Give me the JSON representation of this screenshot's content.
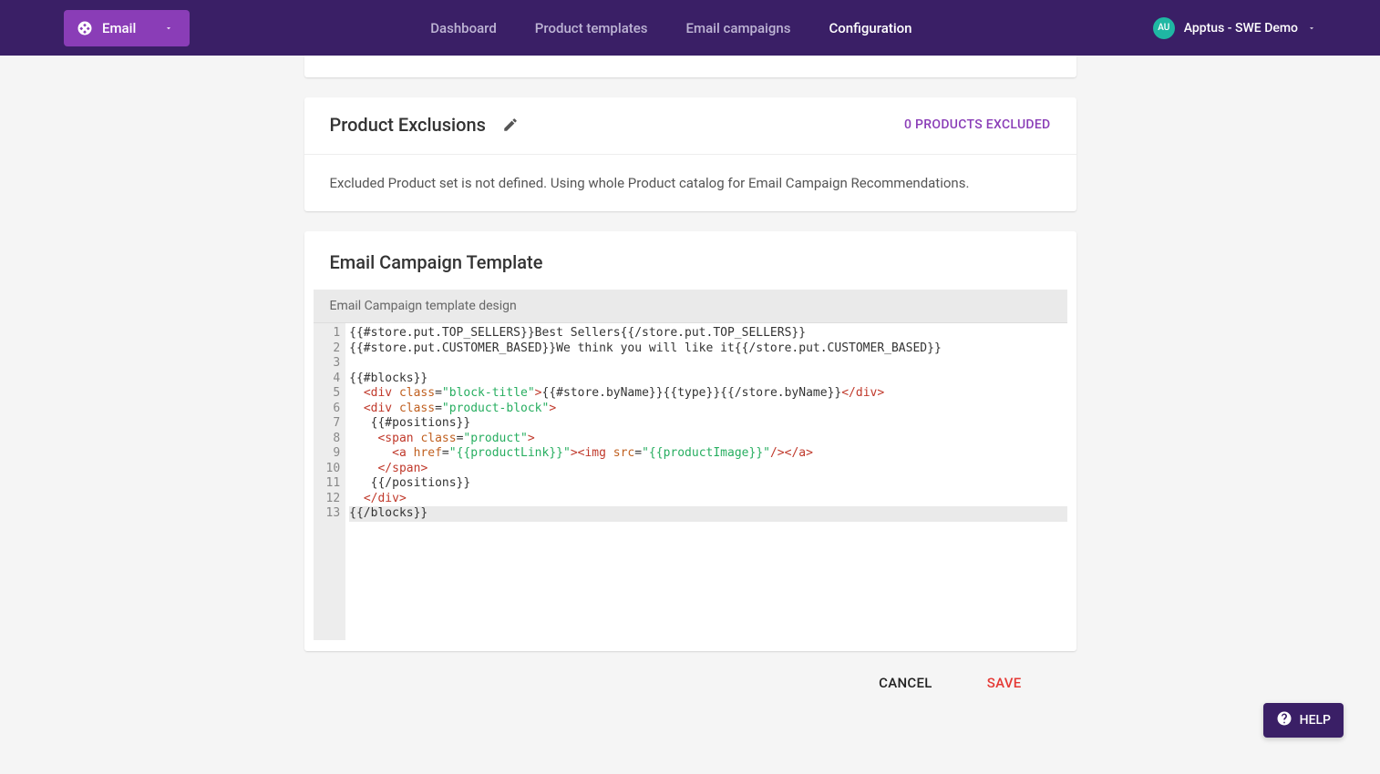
{
  "header": {
    "brand_label": "Email",
    "nav": {
      "dashboard": "Dashboard",
      "product_templates": "Product templates",
      "email_campaigns": "Email campaigns",
      "configuration": "Configuration"
    },
    "user": {
      "avatar_initials": "AU",
      "display_name": "Apptus - SWE Demo"
    }
  },
  "exclusions_card": {
    "title": "Product Exclusions",
    "count_label": "0 PRODUCTS EXCLUDED",
    "body_text": "Excluded Product set is not defined. Using whole Product catalog for Email Campaign Recommendations."
  },
  "template_card": {
    "title": "Email Campaign Template",
    "editor_caption": "Email Campaign template design",
    "code_lines": [
      "{{#store.put.TOP_SELLERS}}Best Sellers{{/store.put.TOP_SELLERS}}",
      "{{#store.put.CUSTOMER_BASED}}We think you will like it{{/store.put.CUSTOMER_BASED}}",
      "",
      "{{#blocks}}",
      "  <div class=\"block-title\">{{#store.byName}}{{type}}{{/store.byName}}</div>",
      "  <div class=\"product-block\">",
      "   {{#positions}}",
      "    <span class=\"product\">",
      "      <a href=\"{{productLink}}\"><img src=\"{{productImage}}\"/></a>",
      "    </span>",
      "   {{/positions}}",
      "  </div>",
      "{{/blocks}}"
    ]
  },
  "actions": {
    "cancel": "CANCEL",
    "save": "SAVE"
  },
  "help": {
    "label": "HELP"
  }
}
